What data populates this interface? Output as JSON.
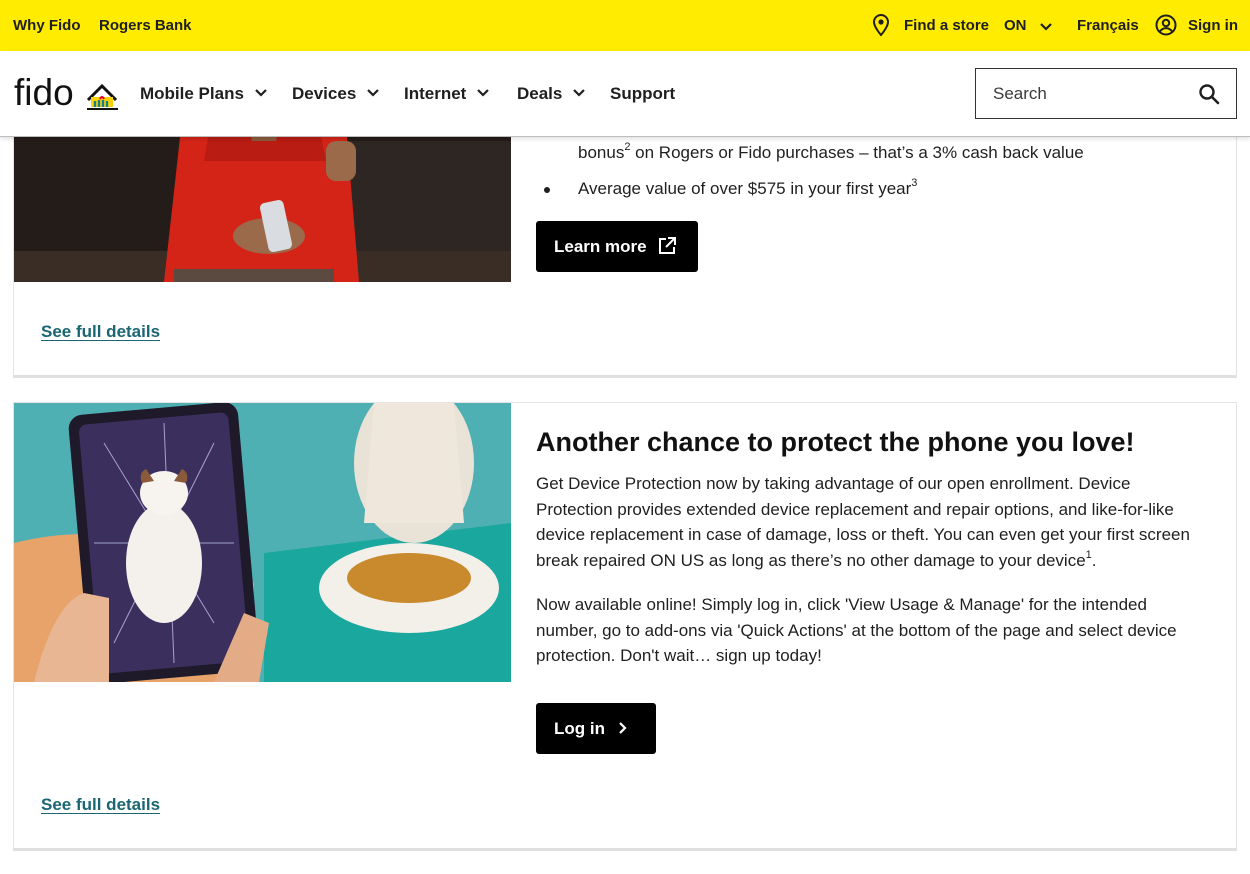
{
  "utility_bar": {
    "why_fido": "Why Fido",
    "rogers_bank": "Rogers Bank",
    "find_store": "Find a store",
    "province": "ON",
    "language": "Français",
    "sign_in": "Sign in"
  },
  "header": {
    "logo_text": "fido",
    "nav": [
      "Mobile Plans",
      "Devices",
      "Internet",
      "Deals",
      "Support"
    ],
    "search_placeholder": "Search"
  },
  "card1": {
    "bullet_continuation_pre": "bonus",
    "bullet_continuation_sup": "2",
    "bullet_continuation_post": " on Rogers or Fido purchases – that’s a 3% cash back value",
    "bullet2_text": "Average value of over $575 in your first year",
    "bullet2_sup": "3",
    "button_label": "Learn more",
    "details_link": "See full details"
  },
  "card2": {
    "title": "Another chance to protect the phone you love!",
    "para1": "Get Device Protection now by taking advantage of our open enrollment. Device Protection provides extended device replacement and repair options, and like-for-like device replacement in case of damage, loss or theft. You can even get your first screen break repaired ON US as long as there’s no other damage to your device",
    "para1_sup": "1",
    "para1_end": ".",
    "para2": "Now available online! Simply log in, click 'View Usage & Manage' for the intended number, go to add-ons via 'Quick Actions' at the bottom of the page and select device protection. Don't wait… sign up today!",
    "button_label": "Log in",
    "details_link": "See full details"
  },
  "colors": {
    "utility_bg": "#ffec00",
    "button_bg": "#000000",
    "link": "#1a6672"
  },
  "icons": [
    "location-pin-icon",
    "chevron-down-icon",
    "user-circle-icon",
    "search-icon",
    "external-link-icon",
    "chevron-right-icon"
  ]
}
